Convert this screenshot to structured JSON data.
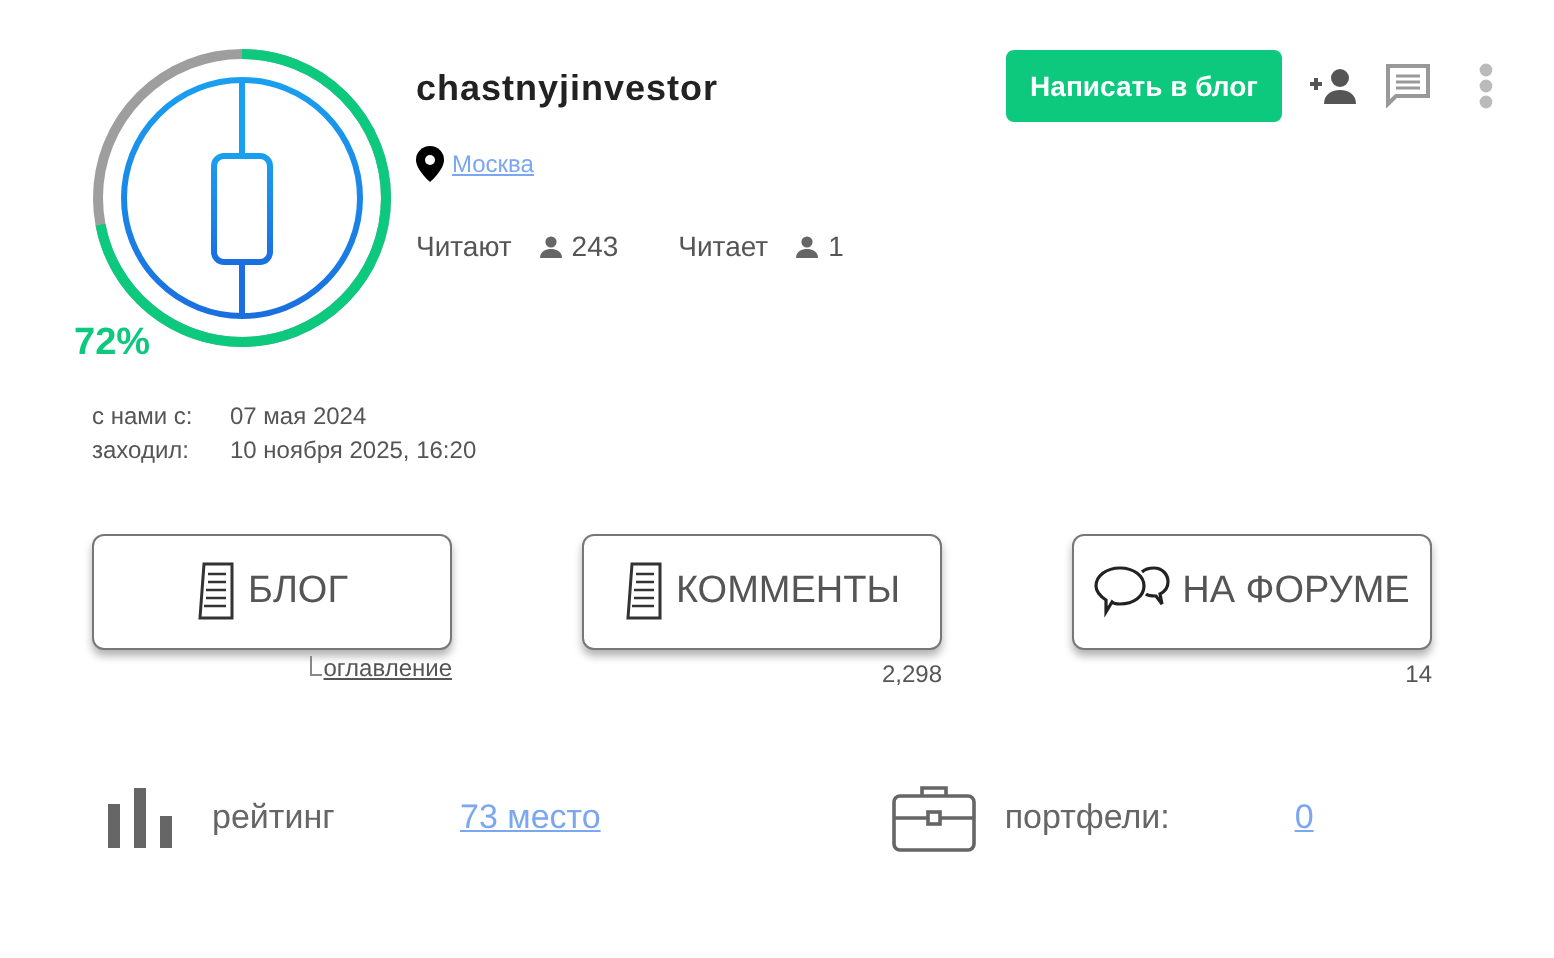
{
  "profile": {
    "username": "chastnyjinvestor",
    "location": "Москва",
    "activity": {
      "label": "72%"
    },
    "followers": [
      {
        "label": "Читают",
        "count": "243"
      },
      {
        "label": "Читает",
        "count": "1"
      }
    ],
    "dates": [
      {
        "label": "с нами с:",
        "value": "07 мая 2024"
      },
      {
        "label": "заходил:",
        "value": "10 ноября 2025, 16:20"
      }
    ]
  },
  "actions": {
    "write_button": "Написать в блог"
  },
  "sections": [
    {
      "kind": "blog",
      "label": "БЛОГ",
      "note": "оглавление"
    },
    {
      "kind": "comments",
      "label": "КОММЕНТЫ",
      "note": "2,298"
    },
    {
      "kind": "forum",
      "label": "НА ФОРУМЕ",
      "note": "14"
    }
  ],
  "stats": [
    {
      "kind": "rating",
      "label": "рейтинг",
      "value": "73 место"
    },
    {
      "kind": "portfolio",
      "label": "портфели:",
      "value": "0"
    }
  ]
}
